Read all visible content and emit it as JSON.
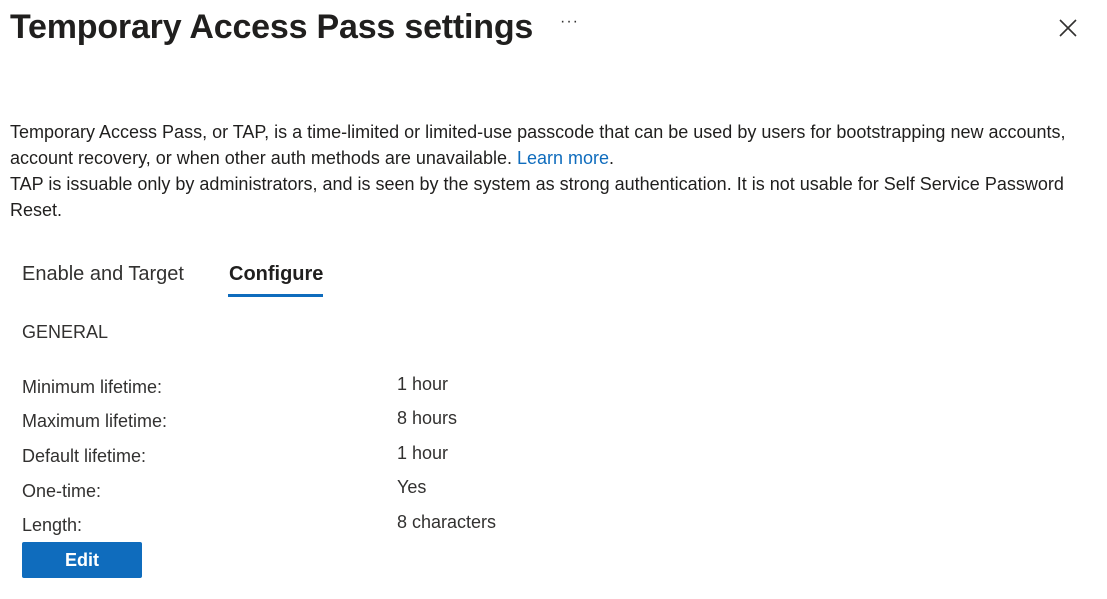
{
  "header": {
    "title": "Temporary Access Pass settings",
    "more_label": "···",
    "close_icon": "close-icon"
  },
  "description": {
    "line1": "Temporary Access Pass, or TAP, is a time-limited or limited-use passcode that can be used by users for bootstrapping new accounts, account recovery, or when other auth methods are unavailable.",
    "learn_more": "Learn more",
    "period": ".",
    "line2": "TAP is issuable only by administrators, and is seen by the system as strong authentication. It is not usable for Self Service Password Reset."
  },
  "tabs": [
    {
      "label": "Enable and Target",
      "active": false
    },
    {
      "label": "Configure",
      "active": true
    }
  ],
  "general": {
    "section_label": "GENERAL",
    "rows": [
      {
        "label": "Minimum lifetime:",
        "value": "1 hour"
      },
      {
        "label": "Maximum lifetime:",
        "value": "8 hours"
      },
      {
        "label": "Default lifetime:",
        "value": "1 hour"
      },
      {
        "label": "One-time:",
        "value": "Yes"
      },
      {
        "label": "Length:",
        "value": "8 characters"
      }
    ]
  },
  "actions": {
    "edit_label": "Edit"
  },
  "colors": {
    "accent": "#0f6cbd",
    "text": "#201f1e"
  }
}
